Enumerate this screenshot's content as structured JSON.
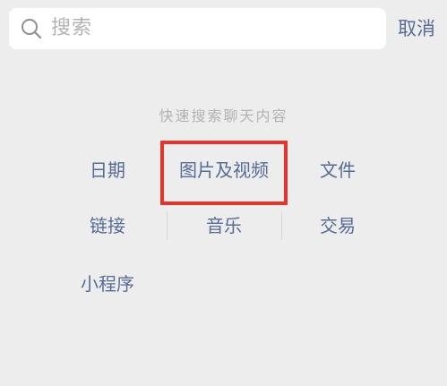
{
  "search": {
    "placeholder": "搜索",
    "icon": "search-icon"
  },
  "header": {
    "cancel_label": "取消"
  },
  "quick_search": {
    "title": "快速搜索聊天内容",
    "categories": [
      {
        "label": "日期"
      },
      {
        "label": "图片及视频"
      },
      {
        "label": "文件"
      },
      {
        "label": "链接"
      },
      {
        "label": "音乐"
      },
      {
        "label": "交易"
      },
      {
        "label": "小程序"
      }
    ]
  },
  "colors": {
    "accent": "#576b95",
    "background": "#ededed",
    "highlight": "#e8332c"
  }
}
